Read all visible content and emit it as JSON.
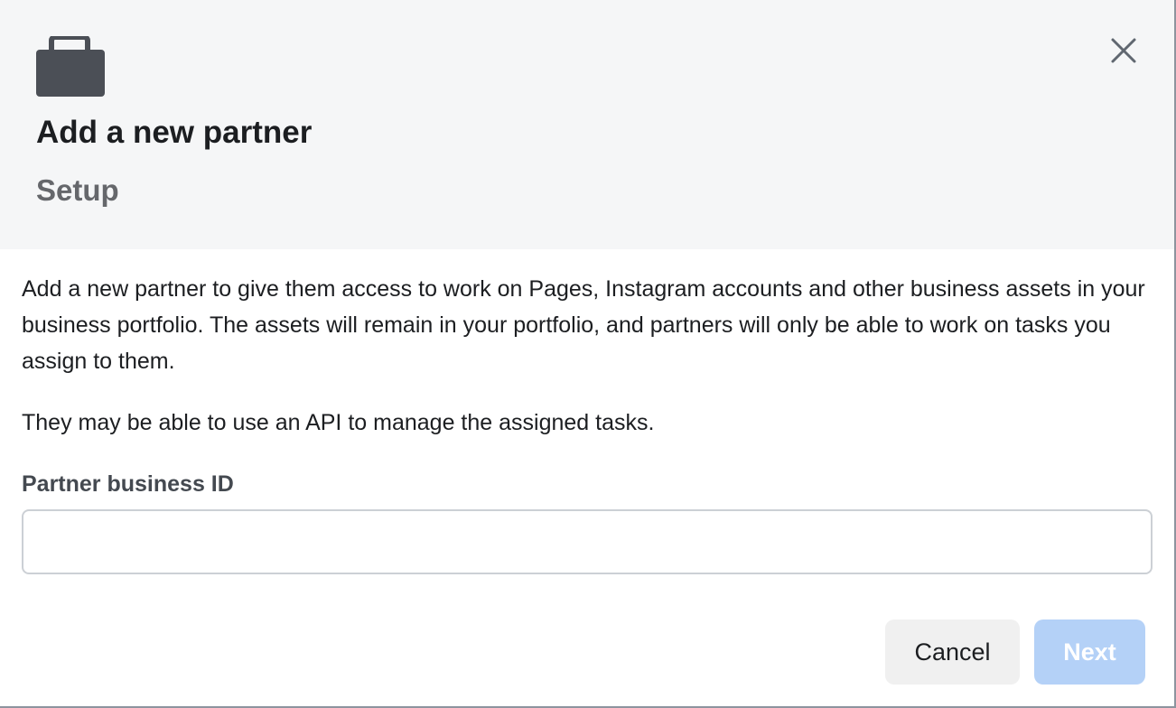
{
  "dialog": {
    "title": "Add a new partner",
    "subtitle": "Setup",
    "header_icon": "briefcase-icon",
    "close_icon": "close-icon",
    "description": "Add a new partner to give them access to work on Pages, Instagram accounts and other business assets in your business portfolio. The assets will remain in your portfolio, and partners will only be able to work on tasks you assign to them.",
    "api_note": "They may be able to use an API to manage the assigned tasks.",
    "field": {
      "label": "Partner business ID",
      "value": "",
      "placeholder": ""
    },
    "buttons": {
      "cancel_label": "Cancel",
      "next_label": "Next",
      "next_disabled": true
    }
  },
  "colors": {
    "header_bg": "#f5f6f7",
    "primary_disabled": "#b4d1f7",
    "text_primary": "#1c1e21",
    "text_secondary": "#65676b"
  }
}
